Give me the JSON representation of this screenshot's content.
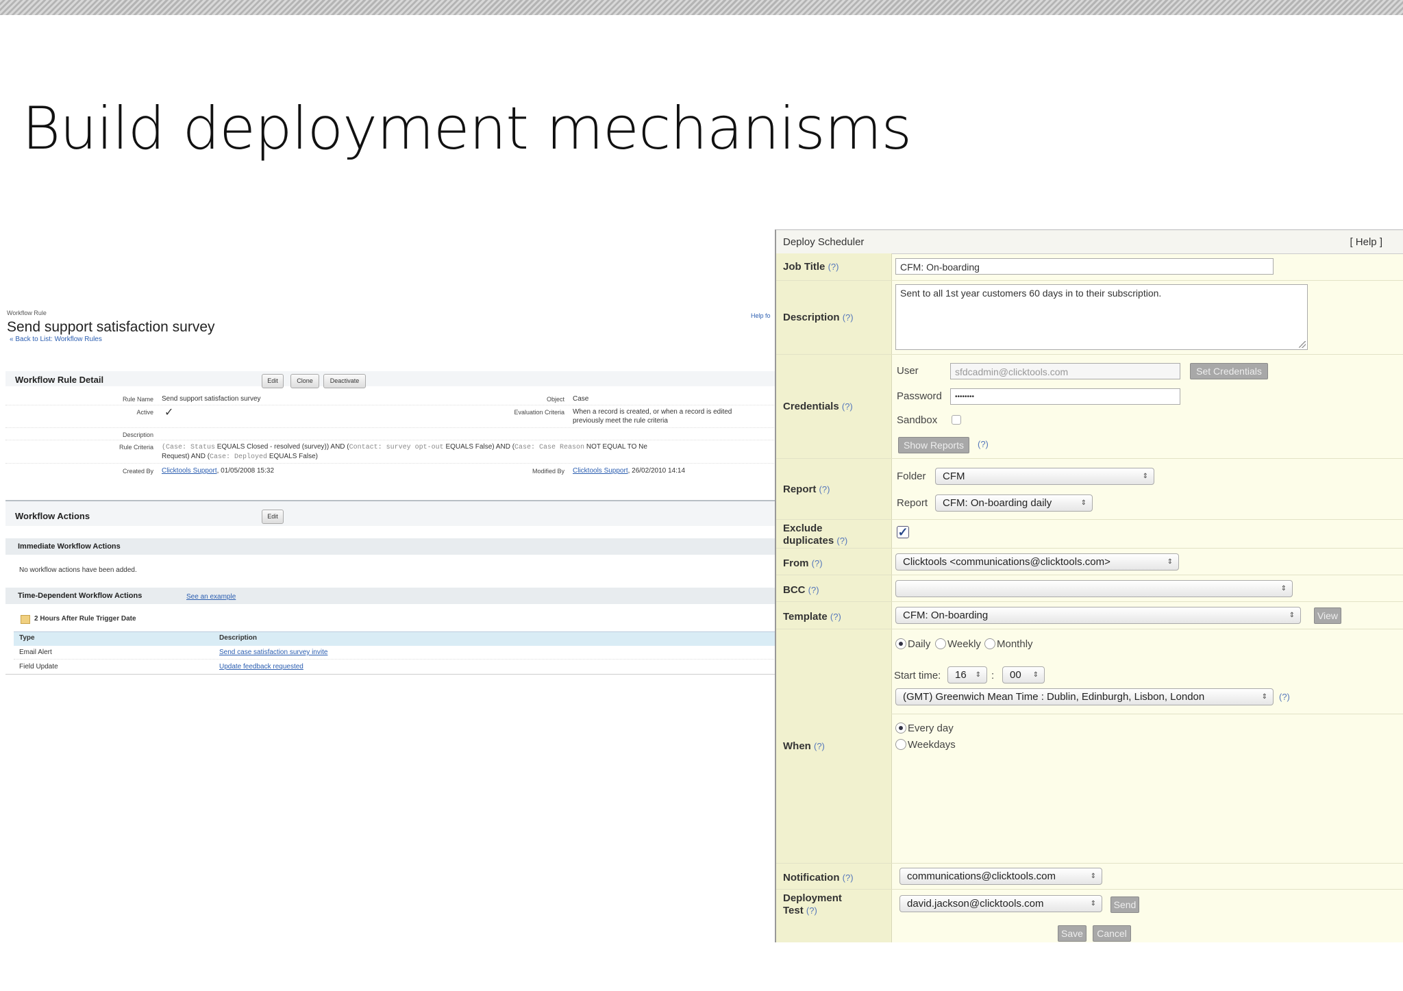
{
  "slide": {
    "title": "Build deployment mechanisms"
  },
  "workflow": {
    "breadcrumb_label": "Workflow Rule",
    "rule_title": "Send support satisfaction survey",
    "back_link": "« Back to List: Workflow Rules",
    "help_link": "Help fo",
    "detail_title": "Workflow Rule Detail",
    "buttons": {
      "edit": "Edit",
      "clone": "Clone",
      "deactivate": "Deactivate"
    },
    "fields": {
      "rule_name_label": "Rule Name",
      "rule_name": "Send support satisfaction survey",
      "active_label": "Active",
      "active_value": "✓",
      "description_label": "Description",
      "rule_criteria_label": "Rule Criteria",
      "criteria_1a": "(Case: Status",
      "criteria_1b": " EQUALS Closed - resolved (survey)) AND (",
      "criteria_1c": "Contact: survey opt-out",
      "criteria_1d": " EQUALS False) AND (",
      "criteria_1e": "Case: Case Reason",
      "criteria_1f": " NOT EQUAL TO Ne",
      "criteria_2a": "Request) AND (",
      "criteria_2b": "Case: Deployed",
      "criteria_2c": " EQUALS False)",
      "created_by_label": "Created By",
      "created_by_name": "Clicktools Support",
      "created_by_date": ", 01/05/2008 15:32",
      "object_label": "Object",
      "object_value": "Case",
      "eval_label": "Evaluation Criteria",
      "eval_line1": "When a record is created, or when a record is edited",
      "eval_line2": "previously meet the rule criteria",
      "modified_by_label": "Modified By",
      "modified_by_name": "Clicktools Support",
      "modified_by_date": ", 26/02/2010 14:14"
    },
    "actions_title": "Workflow Actions",
    "actions_edit": "Edit",
    "immediate_title": "Immediate Workflow Actions",
    "immediate_empty": "No workflow actions have been added.",
    "time_dep_title": "Time-Dependent Workflow Actions",
    "see_example": "See an example",
    "trigger_label": "2 Hours After Rule Trigger Date",
    "table_headers": {
      "type": "Type",
      "description": "Description"
    },
    "table_rows": [
      {
        "type": "Email Alert",
        "description": "Send case satisfaction survey invite"
      },
      {
        "type": "Field Update",
        "description": "Update feedback requested"
      }
    ]
  },
  "scheduler": {
    "title": "Deploy Scheduler",
    "help": "[ Help ]",
    "q": "(?)",
    "job_title_label": "Job Title",
    "job_title_value": "CFM: On-boarding",
    "description_label": "Description",
    "description_value": "Sent to all 1st year customers 60 days in to their subscription.",
    "credentials_label": "Credentials",
    "user_label": "User",
    "user_value": "sfdcadmin@clicktools.com",
    "set_credentials": "Set Credentials",
    "password_label": "Password",
    "password_value": "••••••••",
    "sandbox_label": "Sandbox",
    "show_reports": "Show Reports",
    "report_label": "Report",
    "folder_label": "Folder",
    "folder_value": "CFM",
    "report_sub_label": "Report",
    "report_value": "CFM: On-boarding daily",
    "exclude_label_1": "Exclude",
    "exclude_label_2": "duplicates",
    "exclude_checked": "✓",
    "from_label": "From",
    "from_value": "Clicktools <communications@clicktools.com>",
    "bcc_label": "BCC",
    "bcc_value": "",
    "template_label": "Template",
    "template_value": "CFM: On-boarding",
    "view_button": "View",
    "when_label": "When",
    "freq_daily": "Daily",
    "freq_weekly": "Weekly",
    "freq_monthly": "Monthly",
    "start_time_label": "Start time:",
    "start_hour": "16",
    "time_colon": ":",
    "start_min": "00",
    "timezone": "(GMT) Greenwich Mean Time : Dublin, Edinburgh, Lisbon, London",
    "every_day": "Every day",
    "weekdays": "Weekdays",
    "notification_label": "Notification",
    "notification_value": "communications@clicktools.com",
    "deploy_test_label_1": "Deployment",
    "deploy_test_label_2": "Test",
    "deploy_test_value": "david.jackson@clicktools.com",
    "send_button": "Send",
    "save_button": "Save",
    "cancel_button": "Cancel"
  },
  "icons": {
    "select_arrow": "⇕",
    "calendar": "calendar-icon"
  }
}
